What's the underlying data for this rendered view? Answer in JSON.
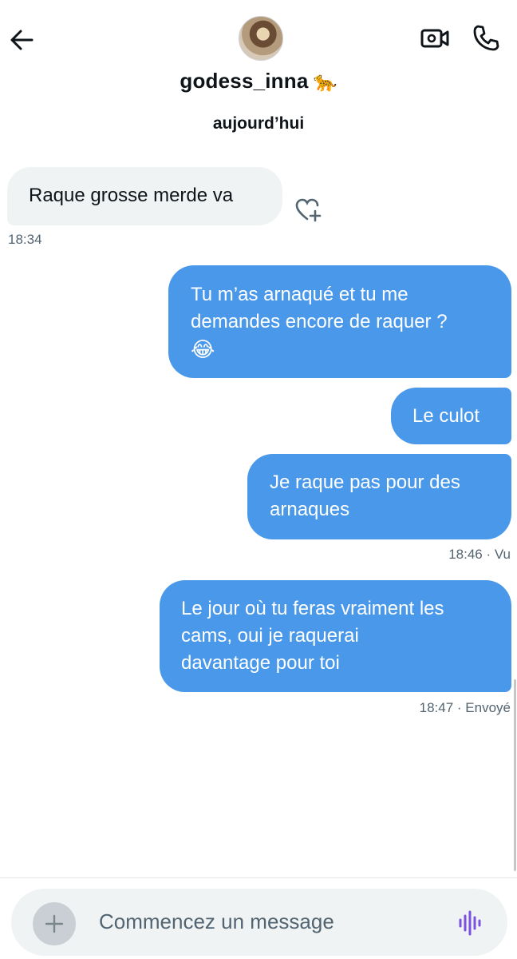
{
  "header": {
    "name": "godess_inna",
    "name_emoji": "🐆",
    "avatar_icon": "avatar"
  },
  "date_label": "aujourd’hui",
  "messages": [
    {
      "dir": "received",
      "text": "Raque grosse merde va",
      "time": "18:34"
    },
    {
      "dir": "sent",
      "text": "Tu m’as arnaqué et tu me demandes encore de raquer ? 😂"
    },
    {
      "dir": "sent",
      "text": "Le culot"
    },
    {
      "dir": "sent",
      "text": "Je raque pas pour des arnaques",
      "time": "18:46",
      "status": "Vu"
    },
    {
      "dir": "sent",
      "text": "Le jour où tu feras vraiment les cams, oui je raquerai davantage pour toi",
      "time": "18:47",
      "status": "Envoyé"
    }
  ],
  "msg": {
    "m1_text": "Raque grosse merde va",
    "m1_time": "18:34",
    "m2_line1": "Tu m’as arnaqué et tu me",
    "m2_line2": "demandes encore de raquer ?",
    "m2_emoji": "😂",
    "m3_text": "Le culot",
    "m4_line1": "Je raque pas pour des",
    "m4_line2": "arnaques",
    "m4_meta": "18:46 · Vu",
    "m5_line1": "Le jour où tu feras vraiment les",
    "m5_line2": "cams, oui je raquerai",
    "m5_line3": "davantage pour toi",
    "m5_meta": "18:47 · Envoyé"
  },
  "composer": {
    "placeholder": "Commencez un message"
  },
  "colors": {
    "sent_bubble": "#4a98e9",
    "received_bubble": "#eff3f4",
    "voice_icon": "#7b52e0"
  }
}
